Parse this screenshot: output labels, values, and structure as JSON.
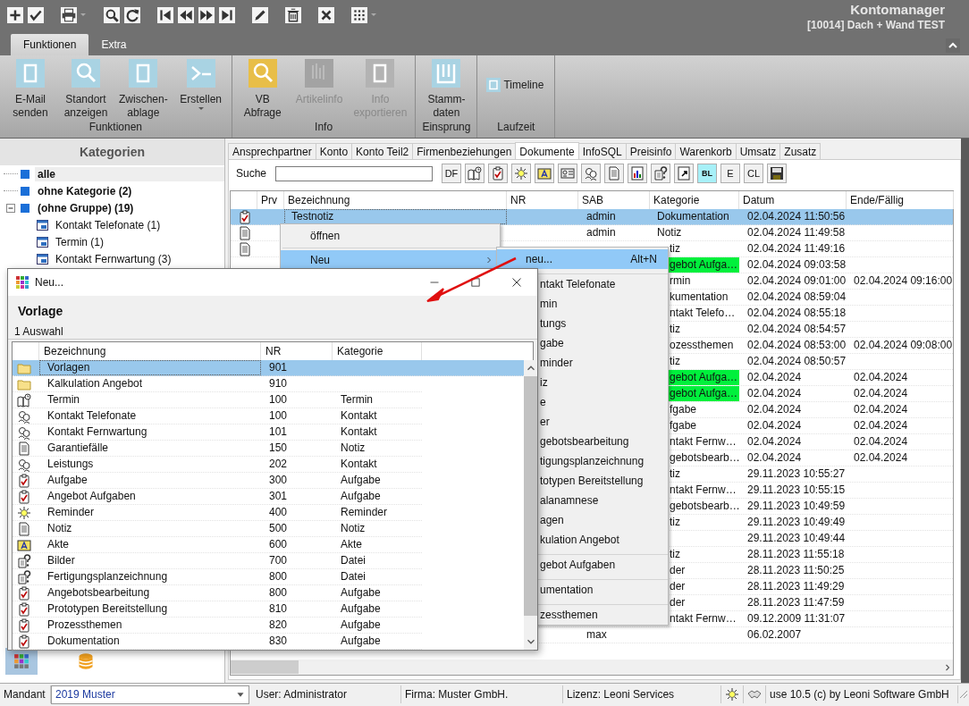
{
  "app": {
    "title": "Kontomanager",
    "subtitle": "[10014] Dach + Wand TEST"
  },
  "ribbon_tabs": [
    {
      "label": "Funktionen",
      "selected": true
    },
    {
      "label": "Extra",
      "selected": false
    }
  ],
  "ribbon_groups": [
    {
      "label": "Funktionen",
      "buttons": [
        {
          "label": "E-Mail\nsenden",
          "kind": "frame",
          "color": "#a9d3e3",
          "disabled": false,
          "dropdown": false
        },
        {
          "label": "Standort\nanzeigen",
          "kind": "search",
          "color": "#a9d3e3",
          "disabled": false,
          "dropdown": false
        },
        {
          "label": "Zwischen-\nablage",
          "kind": "frame",
          "color": "#a9d3e3",
          "disabled": false,
          "dropdown": false
        },
        {
          "label": "Erstellen",
          "kind": "terminal",
          "color": "#a9d3e3",
          "disabled": false,
          "dropdown": true
        }
      ]
    },
    {
      "label": "Info",
      "buttons": [
        {
          "label": "VB\nAbfrage",
          "kind": "search",
          "color": "#e8be48",
          "disabled": false,
          "dropdown": false
        },
        {
          "label": "Artikelinfo",
          "kind": "bars",
          "color": "#a3a3a3",
          "disabled": true,
          "dropdown": false
        },
        {
          "label": "Info\nexportieren",
          "kind": "frame",
          "color": "#b3b3b3",
          "disabled": true,
          "dropdown": false
        }
      ]
    },
    {
      "label": "Einsprung",
      "buttons": [
        {
          "label": "Stamm-\ndaten",
          "kind": "columns",
          "color": "#a9d3e3",
          "disabled": false,
          "dropdown": false
        }
      ]
    },
    {
      "label": "Laufzeit",
      "buttons": [
        {
          "label": "Timeline",
          "kind": "toggle",
          "color": "#a9d3e3",
          "disabled": false,
          "dropdown": false
        }
      ]
    }
  ],
  "sidebar": {
    "title": "Kategorien",
    "tree": [
      {
        "label": "alle",
        "selected": true
      },
      {
        "label": "ohne Kategorie (2)",
        "selected": false
      },
      {
        "label": "(ohne Gruppe) (19)",
        "selected": false,
        "expanded": true,
        "children": [
          {
            "label": "Kontakt Telefonate (1)",
            "selected": false
          },
          {
            "label": "Termin (1)",
            "selected": false
          },
          {
            "label": "Kontakt Fernwartung (3)",
            "selected": false
          }
        ]
      }
    ]
  },
  "doc_tabs": [
    {
      "label": "Ansprechpartner",
      "selected": false
    },
    {
      "label": "Konto",
      "selected": false
    },
    {
      "label": "Konto Teil2",
      "selected": false
    },
    {
      "label": "Firmenbeziehungen",
      "selected": false
    },
    {
      "label": "Dokumente",
      "selected": true
    },
    {
      "label": "InfoSQL",
      "selected": false
    },
    {
      "label": "Preisinfo",
      "selected": false
    },
    {
      "label": "Warenkorb",
      "selected": false
    },
    {
      "label": "Umsatz",
      "selected": false
    },
    {
      "label": "Zusatz",
      "selected": false
    }
  ],
  "search": {
    "label": "Suche"
  },
  "search_tools": [
    {
      "kind": "text",
      "label": "DF"
    },
    {
      "kind": "termin"
    },
    {
      "kind": "task"
    },
    {
      "kind": "sun"
    },
    {
      "kind": "akte"
    },
    {
      "kind": "card"
    },
    {
      "kind": "contacts"
    },
    {
      "kind": "doc"
    },
    {
      "kind": "chart"
    },
    {
      "kind": "question"
    },
    {
      "kind": "shortcut"
    },
    {
      "kind": "tag",
      "label": "BL"
    },
    {
      "kind": "text",
      "label": "E"
    },
    {
      "kind": "text",
      "label": "CL"
    },
    {
      "kind": "save"
    }
  ],
  "table": {
    "columns": [
      "Prv",
      "Bezeichnung",
      "NR",
      "SAB",
      "Kategorie",
      "Datum",
      "Ende/Fällig"
    ],
    "rows": [
      {
        "kind": "task",
        "bezeichnung": "Testnotiz",
        "sab": "admin",
        "kategorie": "Dokumentation",
        "datum": "02.04.2024 11:50:56",
        "selected": true
      },
      {
        "kind": "doc",
        "sab": "admin",
        "kategorie": "Notiz",
        "datum": "02.04.2024 11:49:58",
        "selected": false
      },
      {
        "kind": "doc",
        "kategorie": "tiz",
        "datum": "02.04.2024 11:49:16",
        "selected": false
      },
      {
        "kategorie": "gebot Aufga…",
        "color": "#00f03c",
        "datum": "02.04.2024 09:03:58",
        "selected": false
      },
      {
        "kategorie": "rmin",
        "datum": "02.04.2024 09:01:00",
        "ende": "02.04.2024 09:16:00",
        "selected": false
      },
      {
        "kategorie": "kumentation",
        "datum": "02.04.2024 08:59:04",
        "selected": false
      },
      {
        "kategorie": "ntakt Telefo…",
        "datum": "02.04.2024 08:55:18",
        "selected": false
      },
      {
        "kategorie": "tiz",
        "datum": "02.04.2024 08:54:57",
        "selected": false
      },
      {
        "kategorie": "ozessthemen",
        "datum": "02.04.2024 08:53:00",
        "ende": "02.04.2024 09:08:00",
        "selected": false
      },
      {
        "kategorie": "tiz",
        "datum": "02.04.2024 08:50:57",
        "selected": false
      },
      {
        "kategorie": "gebot Aufga…",
        "color": "#00f03c",
        "datum": "02.04.2024",
        "ende": "02.04.2024",
        "selected": false
      },
      {
        "kategorie": "gebot Aufga…",
        "color": "#00f03c",
        "datum": "02.04.2024",
        "ende": "02.04.2024",
        "selected": false
      },
      {
        "kategorie": "fgabe",
        "datum": "02.04.2024",
        "ende": "02.04.2024",
        "selected": false
      },
      {
        "kategorie": "fgabe",
        "datum": "02.04.2024",
        "ende": "02.04.2024",
        "selected": false
      },
      {
        "kategorie": "ntakt Fernw…",
        "datum": "02.04.2024",
        "ende": "02.04.2024",
        "selected": false
      },
      {
        "kategorie": "gebotsbearb…",
        "datum": "02.04.2024",
        "ende": "02.04.2024",
        "selected": false
      },
      {
        "kategorie": "tiz",
        "datum": "29.11.2023 10:55:27",
        "selected": false
      },
      {
        "kategorie": "ntakt Fernw…",
        "datum": "29.11.2023 10:55:15",
        "selected": false
      },
      {
        "kategorie": "gebotsbearb…",
        "datum": "29.11.2023 10:49:59",
        "selected": false
      },
      {
        "kategorie": "tiz",
        "datum": "29.11.2023 10:49:49",
        "selected": false
      },
      {
        "datum": "29.11.2023 10:49:44",
        "selected": false
      },
      {
        "kategorie": "tiz",
        "datum": "28.11.2023 11:55:18",
        "selected": false
      },
      {
        "kategorie": "der",
        "datum": "28.11.2023 11:50:25",
        "selected": false
      },
      {
        "kategorie": "der",
        "datum": "28.11.2023 11:49:29",
        "selected": false
      },
      {
        "kategorie": "der",
        "datum": "28.11.2023 11:47:59",
        "selected": false
      },
      {
        "kategorie": "ntakt Fernw…",
        "datum": "09.12.2009 11:31:07",
        "selected": false
      },
      {
        "sab": "max",
        "datum": "06.02.2007",
        "selected": false
      }
    ]
  },
  "context_menu": {
    "items": [
      {
        "label": "öffnen",
        "selected": false,
        "submenu": false
      },
      {
        "label": "Neu",
        "selected": true,
        "submenu": true
      }
    ]
  },
  "submenu": {
    "items": [
      {
        "label": "neu...",
        "shortcut": "Alt+N",
        "selected": true,
        "separated": false
      },
      {
        "label": "ntakt Telefonate",
        "selected": false,
        "separated": true
      },
      {
        "label": "min",
        "selected": false,
        "separated": false
      },
      {
        "label": "tungs",
        "selected": false,
        "separated": false
      },
      {
        "label": "gabe",
        "selected": false,
        "separated": false
      },
      {
        "label": "minder",
        "selected": false,
        "separated": false
      },
      {
        "label": "iz",
        "selected": false,
        "separated": false
      },
      {
        "label": "e",
        "selected": false,
        "separated": false
      },
      {
        "label": "er",
        "selected": false,
        "separated": false
      },
      {
        "label": "gebotsbearbeitung",
        "selected": false,
        "separated": false
      },
      {
        "label": "tigungsplanzeichnung",
        "selected": false,
        "separated": false
      },
      {
        "label": "totypen Bereitstellung",
        "selected": false,
        "separated": false
      },
      {
        "label": "alanamnese",
        "selected": false,
        "separated": false
      },
      {
        "label": "agen",
        "selected": false,
        "separated": false
      },
      {
        "label": "kulation Angebot",
        "selected": false,
        "separated": false
      },
      {
        "label": "gebot Aufgaben",
        "selected": false,
        "separated": true
      },
      {
        "label": "umentation",
        "selected": false,
        "separated": true
      },
      {
        "label": "zessthemen",
        "selected": false,
        "separated": true
      }
    ]
  },
  "dialog": {
    "title": "Neu...",
    "heading": "Vorlage",
    "tab": "1 Auswahl",
    "columns": [
      "Bezeichnung",
      "NR",
      "Kategorie"
    ],
    "rows": [
      {
        "kind": "folder",
        "name": "Vorlagen",
        "nr": "901",
        "selected": true
      },
      {
        "kind": "folder",
        "name": "Kalkulation Angebot",
        "nr": "910",
        "selected": false
      },
      {
        "kind": "termin",
        "name": "Termin",
        "nr": "100",
        "kategorie": "Termin",
        "selected": false
      },
      {
        "kind": "contacts",
        "name": "Kontakt Telefonate",
        "nr": "100",
        "kategorie": "Kontakt",
        "selected": false
      },
      {
        "kind": "contacts",
        "name": "Kontakt Fernwartung",
        "nr": "101",
        "kategorie": "Kontakt",
        "selected": false
      },
      {
        "kind": "doc",
        "name": "Garantiefälle",
        "nr": "150",
        "kategorie": "Notiz",
        "selected": false
      },
      {
        "kind": "contacts",
        "name": "Leistungs",
        "nr": "202",
        "kategorie": "Kontakt",
        "selected": false
      },
      {
        "kind": "task",
        "name": "Aufgabe",
        "nr": "300",
        "kategorie": "Aufgabe",
        "selected": false
      },
      {
        "kind": "task",
        "name": "Angebot Aufgaben",
        "nr": "301",
        "kategorie": "Aufgabe",
        "selected": false
      },
      {
        "kind": "sun",
        "name": "Reminder",
        "nr": "400",
        "kategorie": "Reminder",
        "selected": false
      },
      {
        "kind": "doc",
        "name": "Notiz",
        "nr": "500",
        "kategorie": "Notiz",
        "selected": false
      },
      {
        "kind": "akte",
        "name": "Akte",
        "nr": "600",
        "kategorie": "Akte",
        "selected": false
      },
      {
        "kind": "question",
        "name": "Bilder",
        "nr": "700",
        "kategorie": "Datei",
        "selected": false
      },
      {
        "kind": "question",
        "name": "Fertigungsplanzeichnung",
        "nr": "800",
        "kategorie": "Datei",
        "selected": false
      },
      {
        "kind": "task",
        "name": "Angebotsbearbeitung",
        "nr": "800",
        "kategorie": "Aufgabe",
        "selected": false
      },
      {
        "kind": "task",
        "name": "Prototypen Bereitstellung",
        "nr": "810",
        "kategorie": "Aufgabe",
        "selected": false
      },
      {
        "kind": "task",
        "name": "Prozessthemen",
        "nr": "820",
        "kategorie": "Aufgabe",
        "selected": false
      },
      {
        "kind": "task",
        "name": "Dokumentation",
        "nr": "830",
        "kategorie": "Aufgabe",
        "selected": false
      }
    ]
  },
  "status_bar": {
    "mandant_label": "Mandant",
    "mandant": "2019 Muster",
    "user": "User: Administrator",
    "firma": "Firma: Muster GmbH.",
    "lizenz": "Lizenz: Leoni Services",
    "copyright": "use 10.5 (c) by Leoni Software GmbH"
  }
}
